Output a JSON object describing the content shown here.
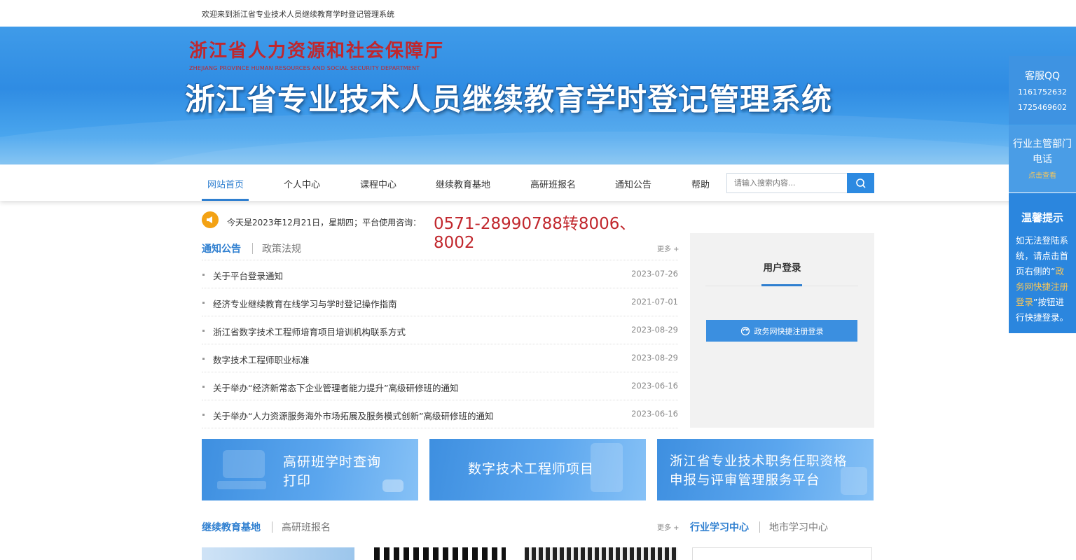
{
  "topbar": {
    "welcome": "欢迎来到浙江省专业技术人员继续教育学时登记管理系统"
  },
  "banner": {
    "dept_cn": "浙江省人力资源和社会保障厅",
    "dept_en": "ZHEJIANG PROVINCE HUMAN RESOURCES AND SOCIAL SECURITY DEPARTMENT",
    "system_title": "浙江省专业技术人员继续教育学时登记管理系统"
  },
  "nav": {
    "items": [
      "网站首页",
      "个人中心",
      "课程中心",
      "继续教育基地",
      "高研班报名",
      "通知公告",
      "帮助"
    ],
    "search_placeholder": "请输入搜索内容..."
  },
  "notice": {
    "text": "今天是2023年12月21日，星期四；平台使用咨询：",
    "phone": "0571-28990788转8006、8002"
  },
  "news_tabs": {
    "active": "通知公告",
    "inactive": "政策法规",
    "more": "更多 +"
  },
  "news": [
    {
      "title": "关于平台登录通知",
      "date": "2023-07-26"
    },
    {
      "title": "经济专业继续教育在线学习与学时登记操作指南",
      "date": "2021-07-01"
    },
    {
      "title": "浙江省数字技术工程师培育项目培训机构联系方式",
      "date": "2023-08-29"
    },
    {
      "title": "数字技术工程师职业标准",
      "date": "2023-08-29"
    },
    {
      "title": "关于举办“经济新常态下企业管理者能力提升”高级研修班的通知",
      "date": "2023-06-16"
    },
    {
      "title": "关于举办“人力资源服务海外市场拓展及服务模式创新”高级研修班的通知",
      "date": "2023-06-16"
    }
  ],
  "login": {
    "title": "用户登录",
    "gov_button": "政务网快捷注册登录"
  },
  "cards": [
    {
      "line1": "高研班学时查询",
      "line2": "打印"
    },
    {
      "line1": "数字技术工程师项目",
      "line2": ""
    },
    {
      "line1": "浙江省专业技术职务任职资格",
      "line2": "申报与评审管理服务平台"
    }
  ],
  "bottom_tabs_left": {
    "active": "继续教育基地",
    "inactive": "高研班报名",
    "more": "更多 +"
  },
  "bottom_tabs_right": {
    "active": "行业学习中心",
    "inactive": "地市学习中心"
  },
  "sidebar": {
    "qq_title": "客服QQ",
    "qq1": "1161752632",
    "qq2": "1725469602",
    "industry_title": "行业主管部门电话",
    "industry_link": "点击查看",
    "tip_title": "温馨提示",
    "tip_text_1": "如无法登陆系统，请点击首页右侧的“",
    "tip_highlight": "政务网快捷注册登录",
    "tip_text_2": "”按钮进行快捷登录。"
  },
  "colors": {
    "accent": "#2f7fd0",
    "phone": "#c1272d",
    "dept": "#c0272d",
    "side_highlight": "#f7c65a"
  }
}
